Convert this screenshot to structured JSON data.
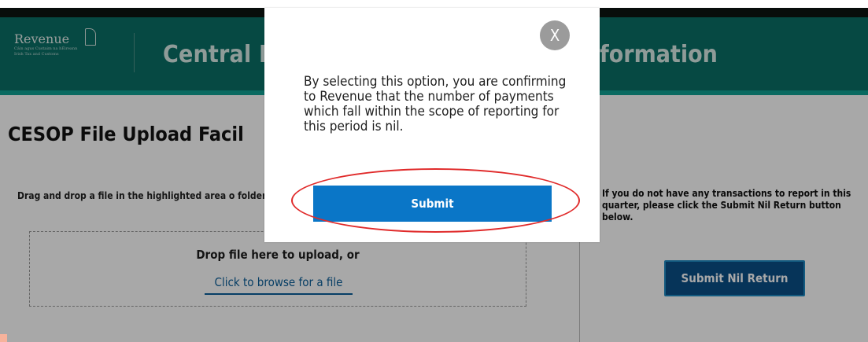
{
  "header": {
    "logo_text": "Revenue",
    "logo_sub_1": "Cáin agus Custaim na hÉireann",
    "logo_sub_2": "Irish Tax and Customs",
    "title_left": "Central E",
    "title_right": "formation"
  },
  "page": {
    "title": "CESOP File Upload Facil",
    "upload_instructions": "Drag and drop a file in the highlighted area o folders.",
    "drop_text": "Drop file here to upload, or",
    "browse_link": "Click to browse for a file",
    "nil_instructions": "If you do not have any transactions to report in this quarter, please click the Submit Nil Return button below.",
    "nil_button": "Submit Nil Return"
  },
  "modal": {
    "close_label": "X",
    "message": "By selecting this option, you are confirming to Revenue that the number of payments which fall within the scope of reporting for this period is nil.",
    "submit_label": "Submit"
  },
  "colors": {
    "header_bg": "#0a6f66",
    "accent_line": "#10a193",
    "primary_button": "#0a76c7",
    "nil_button": "#0a4f88",
    "highlight": "#e02a2a"
  }
}
